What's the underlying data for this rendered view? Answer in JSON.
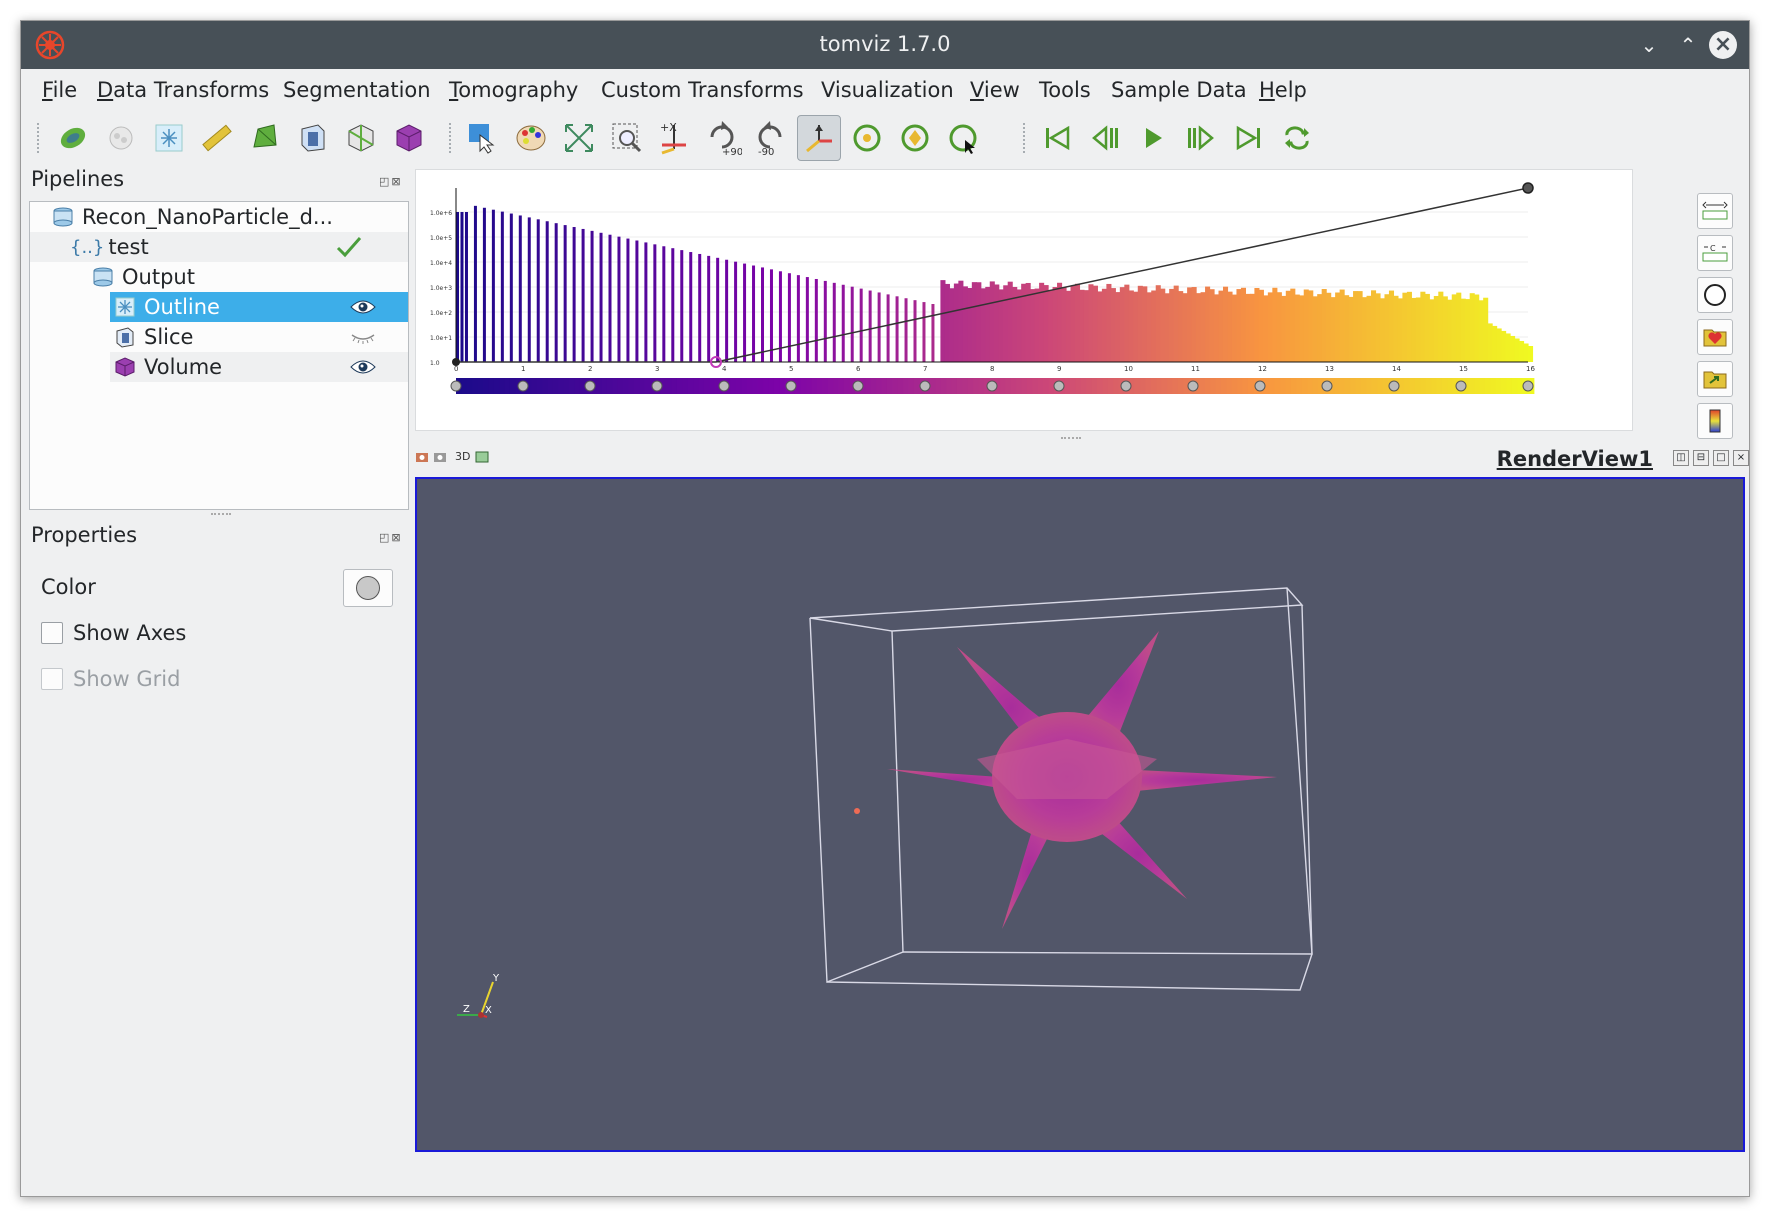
{
  "window": {
    "title": "tomviz 1.7.0",
    "controls": [
      "minimize",
      "maximize",
      "close"
    ]
  },
  "menu": [
    {
      "label": "File",
      "mnemonic": "F",
      "rest": "ile"
    },
    {
      "label": "Data Transforms",
      "mnemonic": "D",
      "rest": "ata Transforms"
    },
    {
      "label": "Segmentation",
      "mnemonic": "",
      "rest": "Segmentation"
    },
    {
      "label": "Tomography",
      "mnemonic": "T",
      "rest": "omography"
    },
    {
      "label": "Custom Transforms",
      "mnemonic": "",
      "rest": "Custom Transforms"
    },
    {
      "label": "Visualization",
      "mnemonic": "",
      "rest": "Visualization"
    },
    {
      "label": "View",
      "mnemonic": "V",
      "rest": "iew"
    },
    {
      "label": "Tools",
      "mnemonic": "",
      "rest": "Tools"
    },
    {
      "label": "Sample Data",
      "mnemonic": "",
      "rest": "Sample Data"
    },
    {
      "label": "Help",
      "mnemonic": "H",
      "rest": "elp"
    }
  ],
  "toolbar": {
    "rotate_plus_label": "+90",
    "rotate_minus_label": "-90",
    "axis_label": "+X"
  },
  "pipelines": {
    "title": "Pipelines",
    "items": [
      {
        "label": "Recon_NanoParticle_d...",
        "icon": "dataset-icon"
      },
      {
        "label": "test",
        "icon": "python-transform-icon",
        "status": "check-icon"
      },
      {
        "label": "Output",
        "icon": "dataset-icon"
      },
      {
        "label": "Outline",
        "icon": "outline-icon",
        "visible": true,
        "selected": true
      },
      {
        "label": "Slice",
        "icon": "slice-icon",
        "visible": false
      },
      {
        "label": "Volume",
        "icon": "volume-icon",
        "visible": true
      }
    ]
  },
  "properties": {
    "title": "Properties",
    "color_label": "Color",
    "color_value": "#c8c8c8",
    "show_axes_label": "Show Axes",
    "show_axes_checked": false,
    "show_grid_label": "Show Grid",
    "show_grid_enabled": false
  },
  "histogram": {
    "x_ticks": [
      "0",
      "1",
      "2",
      "3",
      "4",
      "5",
      "6",
      "7",
      "8",
      "9",
      "10",
      "11",
      "12",
      "13",
      "14",
      "15",
      "16"
    ],
    "y_ticks": [
      "1.0",
      "1.0e+1",
      "1.0e+2",
      "1.0e+3",
      "1.0e+4",
      "1.0e+5",
      "1.0e+6"
    ]
  },
  "render_view": {
    "title": "RenderView1",
    "mode_label": "3D",
    "background": "#525669",
    "orientation_axes": [
      "Y",
      "Z",
      "X"
    ]
  },
  "colors": {
    "selection": "#3daee9",
    "titlebar": "#475057",
    "check": "#4a9e3c"
  }
}
